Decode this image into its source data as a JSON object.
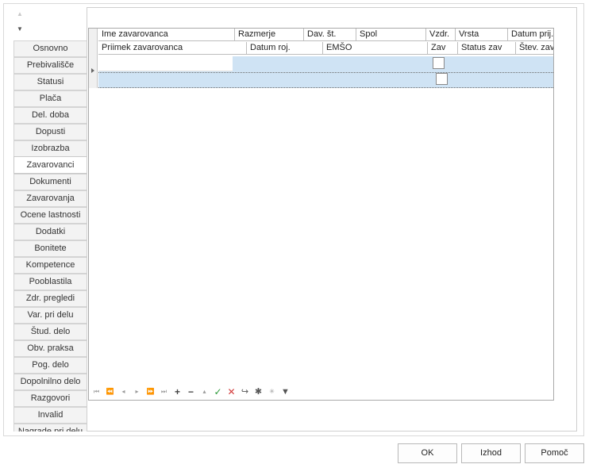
{
  "tabs": [
    {
      "label": "Osnovno"
    },
    {
      "label": "Prebivališče"
    },
    {
      "label": "Statusi"
    },
    {
      "label": "Plača"
    },
    {
      "label": "Del. doba"
    },
    {
      "label": "Dopusti"
    },
    {
      "label": "Izobrazba"
    },
    {
      "label": "Zavarovanci"
    },
    {
      "label": "Dokumenti"
    },
    {
      "label": "Zavarovanja"
    },
    {
      "label": "Ocene lastnosti"
    },
    {
      "label": "Dodatki"
    },
    {
      "label": "Bonitete"
    },
    {
      "label": "Kompetence"
    },
    {
      "label": "Pooblastila"
    },
    {
      "label": "Zdr. pregledi"
    },
    {
      "label": "Var. pri delu"
    },
    {
      "label": "Štud. delo"
    },
    {
      "label": "Obv. praksa"
    },
    {
      "label": "Pog. delo"
    },
    {
      "label": "Dopolnilno delo"
    },
    {
      "label": "Razgovori"
    },
    {
      "label": "Invalid"
    },
    {
      "label": "Nagrade pri delu"
    }
  ],
  "active_tab": "Zavarovanci",
  "grid": {
    "header_row1": [
      "Ime zavarovanca",
      "Razmerje",
      "Dav. št.",
      "Spol",
      "Vzdr.",
      "Vrsta",
      "Datum prij."
    ],
    "header_row2": [
      "Priimek zavarovanca",
      "Datum roj.",
      "EMŠO",
      "Zav",
      "Status zav",
      "Štev. zav"
    ]
  },
  "navigator_icons": [
    "first-icon",
    "prev-page-icon",
    "prev-icon",
    "next-icon",
    "next-page-icon",
    "last-icon",
    "add-icon",
    "delete-icon",
    "edit-icon",
    "post-icon",
    "cancel-icon",
    "refresh-icon",
    "bookmark-icon",
    "goto-bookmark-icon",
    "filter-icon"
  ],
  "buttons": {
    "ok": "OK",
    "exit": "Izhod",
    "help": "Pomoč"
  }
}
